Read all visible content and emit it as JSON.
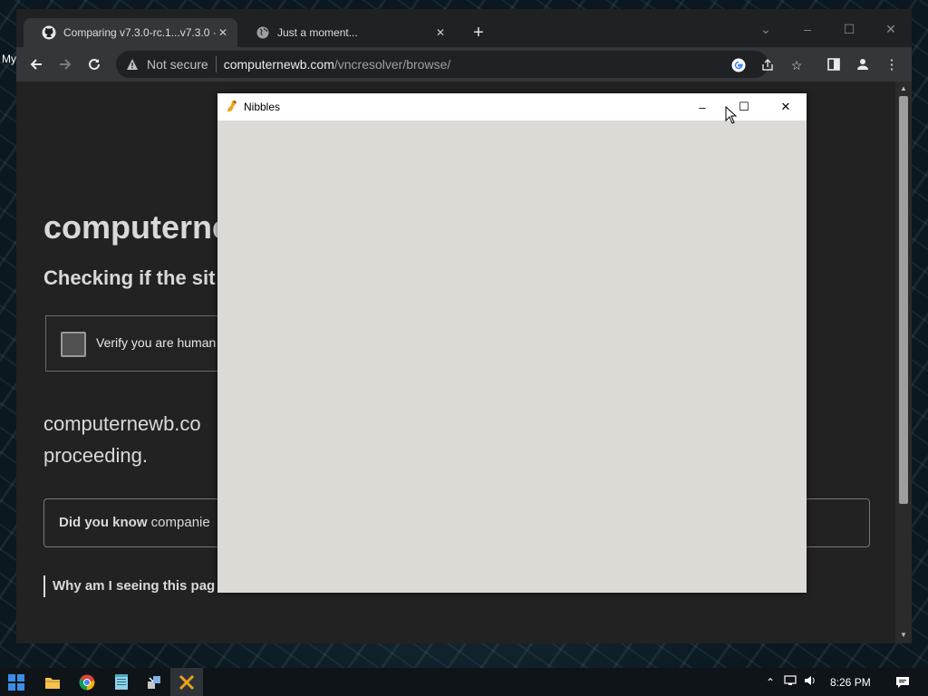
{
  "desktop": {
    "left_label": "My"
  },
  "browser": {
    "tabs": [
      {
        "title": "Comparing v7.3.0-rc.1...v7.3.0 · P",
        "icon": "github-icon",
        "active": true
      },
      {
        "title": "Just a moment...",
        "icon": "globe-icon",
        "active": false
      }
    ],
    "new_tab_label": "+",
    "omnibox": {
      "security_text": "Not secure",
      "host": "computernewb.com",
      "path": "/vncresolver/browse/"
    }
  },
  "page": {
    "heading": "computerne",
    "subheading": "Checking if the sit",
    "verify_label": "Verify you are human",
    "paragraph_line1": "computernewb.co",
    "paragraph_line2": "proceeding.",
    "dyk_bold": "Did you know",
    "dyk_text": " companie",
    "why_text": "Why am I seeing this pag"
  },
  "nibbles": {
    "title": "Nibbles",
    "minimize": "–",
    "maximize": "☐",
    "close": "✕"
  },
  "taskbar": {
    "clock": "8:26 PM"
  },
  "colors": {
    "page_bg": "#222222",
    "nibbles_client": "#dcdad5",
    "browser_chrome": "#202124",
    "toolbar": "#35363a"
  }
}
